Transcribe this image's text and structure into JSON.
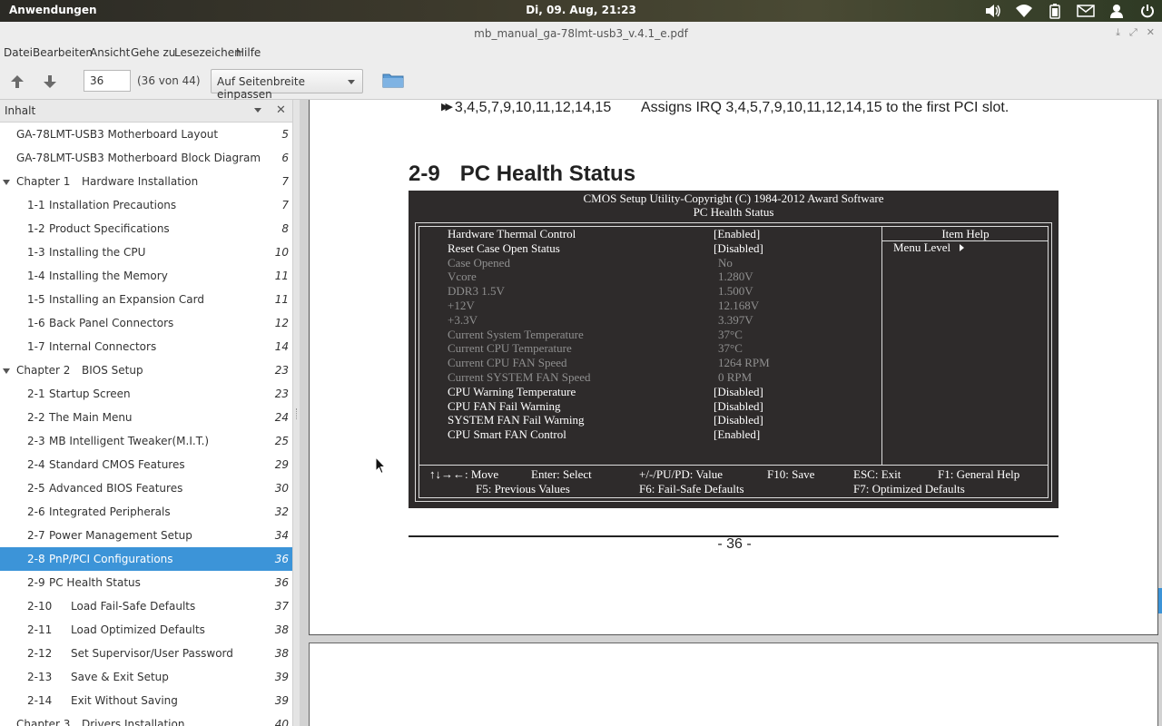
{
  "topbar": {
    "apps_label": "Anwendungen",
    "clock": "Di, 09. Aug, 21:23",
    "tray_icons": [
      "volume-icon",
      "wifi-icon",
      "battery-icon",
      "mail-icon",
      "user-icon",
      "power-icon"
    ]
  },
  "window": {
    "title": "mb_manual_ga-78lmt-usb3_v.4.1_e.pdf"
  },
  "menu": [
    "Datei",
    "Bearbeiten",
    "Ansicht",
    "Gehe zu",
    "Lesezeichen",
    "Hilfe"
  ],
  "toolbar": {
    "page_value": "36",
    "page_of": "(36 von 44)",
    "zoom": "Auf Seitenbreite einpassen"
  },
  "sidebar": {
    "title": "Inhalt",
    "items": [
      {
        "label": "GA-78LMT-USB3 Motherboard Layout",
        "page": "5"
      },
      {
        "label": "GA-78LMT-USB3 Motherboard Block Diagram",
        "page": "6"
      },
      {
        "label": "Chapter 1",
        "label2": "Hardware Installation",
        "page": "7"
      },
      {
        "label": "1-1",
        "label2": "Installation Precautions",
        "page": "7"
      },
      {
        "label": "1-2",
        "label2": "Product Specifications",
        "page": "8"
      },
      {
        "label": "1-3",
        "label2": "Installing the CPU",
        "page": "10"
      },
      {
        "label": "1-4",
        "label2": "Installing the Memory",
        "page": "11"
      },
      {
        "label": "1-5",
        "label2": "Installing an Expansion Card",
        "page": "11"
      },
      {
        "label": "1-6",
        "label2": "Back Panel Connectors",
        "page": "12"
      },
      {
        "label": "1-7",
        "label2": "Internal Connectors",
        "page": "14"
      },
      {
        "label": "Chapter 2",
        "label2": "BIOS Setup",
        "page": "23"
      },
      {
        "label": "2-1",
        "label2": "Startup Screen",
        "page": "23"
      },
      {
        "label": "2-2",
        "label2": "The Main Menu",
        "page": "24"
      },
      {
        "label": "2-3",
        "label2": "MB Intelligent Tweaker(M.I.T.)",
        "page": "25"
      },
      {
        "label": "2-4",
        "label2": "Standard CMOS Features",
        "page": "29"
      },
      {
        "label": "2-5",
        "label2": "Advanced BIOS Features",
        "page": "30"
      },
      {
        "label": "2-6",
        "label2": "Integrated Peripherals",
        "page": "32"
      },
      {
        "label": "2-7",
        "label2": "Power Management Setup",
        "page": "34"
      },
      {
        "label": "2-8",
        "label2": "PnP/PCI Configurations",
        "page": "36"
      },
      {
        "label": "2-9",
        "label2": "PC Health Status",
        "page": "36"
      },
      {
        "label": "2-10",
        "label2": "Load Fail-Safe Defaults",
        "page": "37"
      },
      {
        "label": "2-11",
        "label2": "Load Optimized Defaults",
        "page": "38"
      },
      {
        "label": "2-12",
        "label2": "Set Supervisor/User Password",
        "page": "38"
      },
      {
        "label": "2-13",
        "label2": "Save & Exit Setup",
        "page": "39"
      },
      {
        "label": "2-14",
        "label2": "Exit Without Saving",
        "page": "39"
      },
      {
        "label": "Chapter 3",
        "label2": "Drivers Installation",
        "page": "40"
      }
    ]
  },
  "document": {
    "irq_values": "3,4,5,7,9,10,11,12,14,15",
    "irq_desc": "Assigns IRQ 3,4,5,7,9,10,11,12,14,15 to the first PCI slot.",
    "section_num": "2-9",
    "section_title": "PC Health Status",
    "bios": {
      "header1": "CMOS Setup Utility-Copyright (C) 1984-2012 Award Software",
      "header2": "PC Health Status",
      "rows": [
        {
          "label": "Hardware Thermal Control",
          "value": "[Enabled]"
        },
        {
          "label": "Reset Case Open Status",
          "value": "[Disabled]"
        },
        {
          "label": "Case Opened",
          "value": "No"
        },
        {
          "label": "Vcore",
          "value": "1.280V"
        },
        {
          "label": "DDR3 1.5V",
          "value": "1.500V"
        },
        {
          "label": "+12V",
          "value": "12.168V"
        },
        {
          "label": "+3.3V",
          "value": "3.397V"
        },
        {
          "label": "Current System Temperature",
          "value": "37°C"
        },
        {
          "label": "Current CPU Temperature",
          "value": "37°C"
        },
        {
          "label": "Current CPU FAN Speed",
          "value": "1264 RPM"
        },
        {
          "label": "Current SYSTEM FAN Speed",
          "value": "0 RPM"
        },
        {
          "label": "CPU Warning Temperature",
          "value": "[Disabled]"
        },
        {
          "label": "CPU FAN Fail Warning",
          "value": "[Disabled]"
        },
        {
          "label": "SYSTEM FAN Fail Warning",
          "value": "[Disabled]"
        },
        {
          "label": "CPU Smart FAN Control",
          "value": "[Enabled]"
        }
      ],
      "help_title": "Item Help",
      "help_menu_level": "Menu Level",
      "keys": {
        "move": "↑↓→←: Move",
        "select": "Enter: Select",
        "value": "+/-/PU/PD: Value",
        "save": "F10: Save",
        "exit": "ESC: Exit",
        "help": "F1: General Help",
        "prev": "F5: Previous Values",
        "failsafe": "F6: Fail-Safe Defaults",
        "optimized": "F7: Optimized Defaults"
      }
    },
    "page_number": "- 36 -"
  },
  "colors": {
    "selection": "#3c94d8",
    "bios_bg": "#2e2b2b"
  }
}
